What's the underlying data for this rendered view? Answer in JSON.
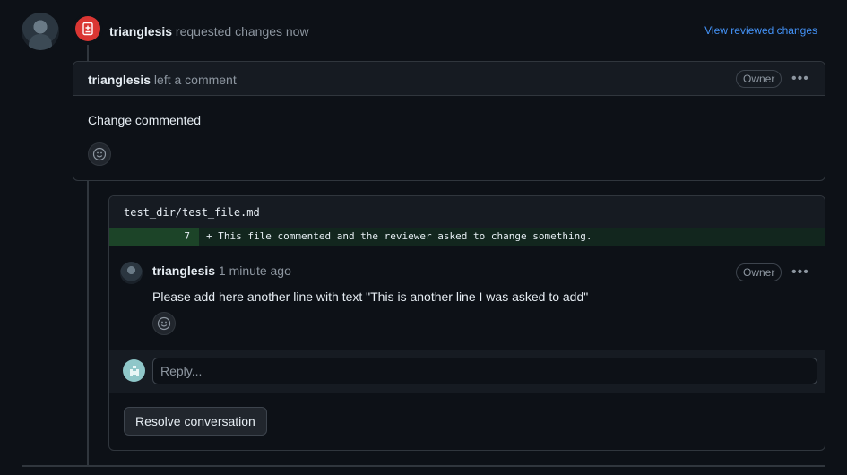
{
  "review": {
    "user": "trianglesis",
    "action": "requested changes now",
    "view_link": "View reviewed changes"
  },
  "comment1": {
    "user": "trianglesis",
    "action": "left a comment",
    "badge": "Owner",
    "body": "Change commented",
    "more_label": "•••"
  },
  "diff": {
    "file_path": "test_dir/test_file.md",
    "line_number": "7",
    "line_code": "+ This file commented and the reviewer asked to change something."
  },
  "comment2": {
    "user": "trianglesis",
    "time": "1 minute ago",
    "badge": "Owner",
    "body": "Please add here another line with text \"This is another line I was asked to add\"",
    "more_label": "•••"
  },
  "reply": {
    "placeholder": "Reply..."
  },
  "resolve_button": "Resolve conversation",
  "icons": {
    "status": "file-diff-icon",
    "emoji": "smiley-icon",
    "more": "kebab-horizontal-icon"
  },
  "colors": {
    "background": "#0d1117",
    "changes_requested": "#da3633",
    "link": "#4493f8",
    "diff_added": "#12261e"
  }
}
